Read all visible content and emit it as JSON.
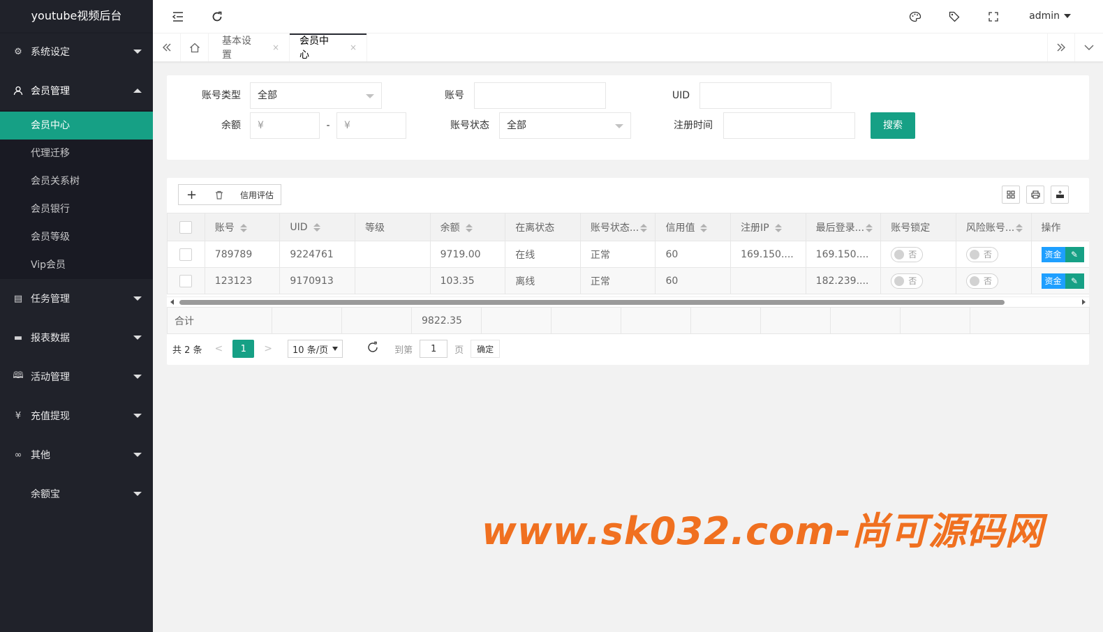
{
  "app": {
    "title": "youtube视频后台"
  },
  "sidebar": {
    "items": [
      {
        "label": "系统设定",
        "icon": "gear-icon"
      },
      {
        "label": "会员管理",
        "icon": "user-icon",
        "children": [
          "会员中心",
          "代理迁移",
          "会员关系树",
          "会员银行",
          "会员等级",
          "Vip会员"
        ]
      },
      {
        "label": "任务管理",
        "icon": "task-icon"
      },
      {
        "label": "报表数据",
        "icon": "report-icon"
      },
      {
        "label": "活动管理",
        "icon": "activity-icon"
      },
      {
        "label": "充值提现",
        "icon": "money-icon"
      },
      {
        "label": "其他",
        "icon": "link-icon"
      },
      {
        "label": "余额宝",
        "icon": "wallet-icon"
      }
    ],
    "active_child": "会员中心"
  },
  "header": {
    "user": "admin"
  },
  "tabs": [
    {
      "label": "基本设置",
      "close": "×"
    },
    {
      "label": "会员中心",
      "close": "×",
      "active": true
    }
  ],
  "filters": {
    "account_type_label": "账号类型",
    "account_type_value": "全部",
    "account_label": "账号",
    "uid_label": "UID",
    "balance_label": "余额",
    "balance_min_placeholder": "¥",
    "balance_sep": "-",
    "balance_max_placeholder": "¥",
    "account_status_label": "账号状态",
    "account_status_value": "全部",
    "reg_time_label": "注册时间",
    "search_button": "搜索"
  },
  "toolbar": {
    "add": "+",
    "delete": "🗑",
    "credit": "信用评估"
  },
  "table": {
    "headers": [
      "账号",
      "UID",
      "等级",
      "余额",
      "在离状态",
      "账号状态...",
      "信用值",
      "注册IP",
      "最后登录...",
      "账号锁定",
      "风险账号...",
      "操作"
    ],
    "rows": [
      {
        "account": "789789",
        "uid": "9224761",
        "level": "",
        "balance": "9719.00",
        "online": "在线",
        "status": "正常",
        "credit": "60",
        "reg_ip": "169.150....",
        "last_login": "169.150....",
        "lock": "否",
        "risk": "否"
      },
      {
        "account": "123123",
        "uid": "9170913",
        "level": "",
        "balance": "103.35",
        "online": "离线",
        "status": "正常",
        "credit": "60",
        "reg_ip": "",
        "last_login": "182.239....",
        "lock": "否",
        "risk": "否"
      }
    ],
    "op_fund": "资金",
    "total_label": "合计",
    "total_balance": "9822.35"
  },
  "pager": {
    "count": "共 2 条",
    "current": "1",
    "page_size": "10 条/页",
    "goto_label": "到第",
    "goto_value": "1",
    "page_suffix": "页",
    "confirm": "确定"
  },
  "watermark": "www.sk032.com-尚可源码网",
  "colors": {
    "accent": "#16a085",
    "sidebar": "#20222a",
    "fund": "#1e9fff",
    "watermark": "#f07020"
  }
}
